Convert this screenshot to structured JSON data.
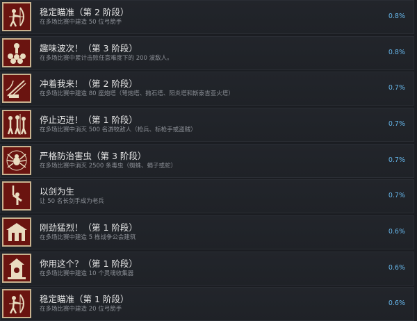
{
  "achievements": [
    {
      "title": "稳定瞄准（第 2 阶段）",
      "desc": "在多场比赛中建造 50 位弓箭手",
      "pct": "0.8%",
      "icon": "archer-icon"
    },
    {
      "title": "趣味波次！（第 3 阶段）",
      "desc": "在多场比赛中累计击败任意难度下的 200 波敌人。",
      "pct": "0.8%",
      "icon": "skull-pile-icon"
    },
    {
      "title": "冲着我来！（第 2 阶段）",
      "desc": "在多场比赛中建造 80 座炮塔（弩炮塔、抛石塔、阳炎塔和斯泰吉亚火塔）",
      "pct": "0.7%",
      "icon": "ballista-icon"
    },
    {
      "title": "停止迈进！（第 1 阶段）",
      "desc": "在多场比赛中消灭 500 名游牧敌人（枪兵、标枪手或盗贼）",
      "pct": "0.7%",
      "icon": "nomads-icon"
    },
    {
      "title": "严格防治害虫（第 3 阶段）",
      "desc": "在多场比赛中消灭 2500 条毒虫（蜘蛛、蝎子或蛇）",
      "pct": "0.7%",
      "icon": "spider-icon"
    },
    {
      "title": "以剑为生",
      "desc": "让 50 名长剑手成为老兵",
      "pct": "0.7%",
      "icon": "sword-raised-icon"
    },
    {
      "title": "刚劲猛烈！（第 1 阶段）",
      "desc": "在多场比赛中建造 5 栋战争公会建筑",
      "pct": "0.6%",
      "icon": "war-guild-icon"
    },
    {
      "title": "你用这个？（第 1 阶段）",
      "desc": "在多场比赛中建造 10 个灵魂收集器",
      "pct": "0.6%",
      "icon": "soul-collector-icon"
    },
    {
      "title": "稳定瞄准（第 1 阶段）",
      "desc": "在多场比赛中建造 20 位弓箭手",
      "pct": "0.6%",
      "icon": "archer-icon"
    }
  ]
}
